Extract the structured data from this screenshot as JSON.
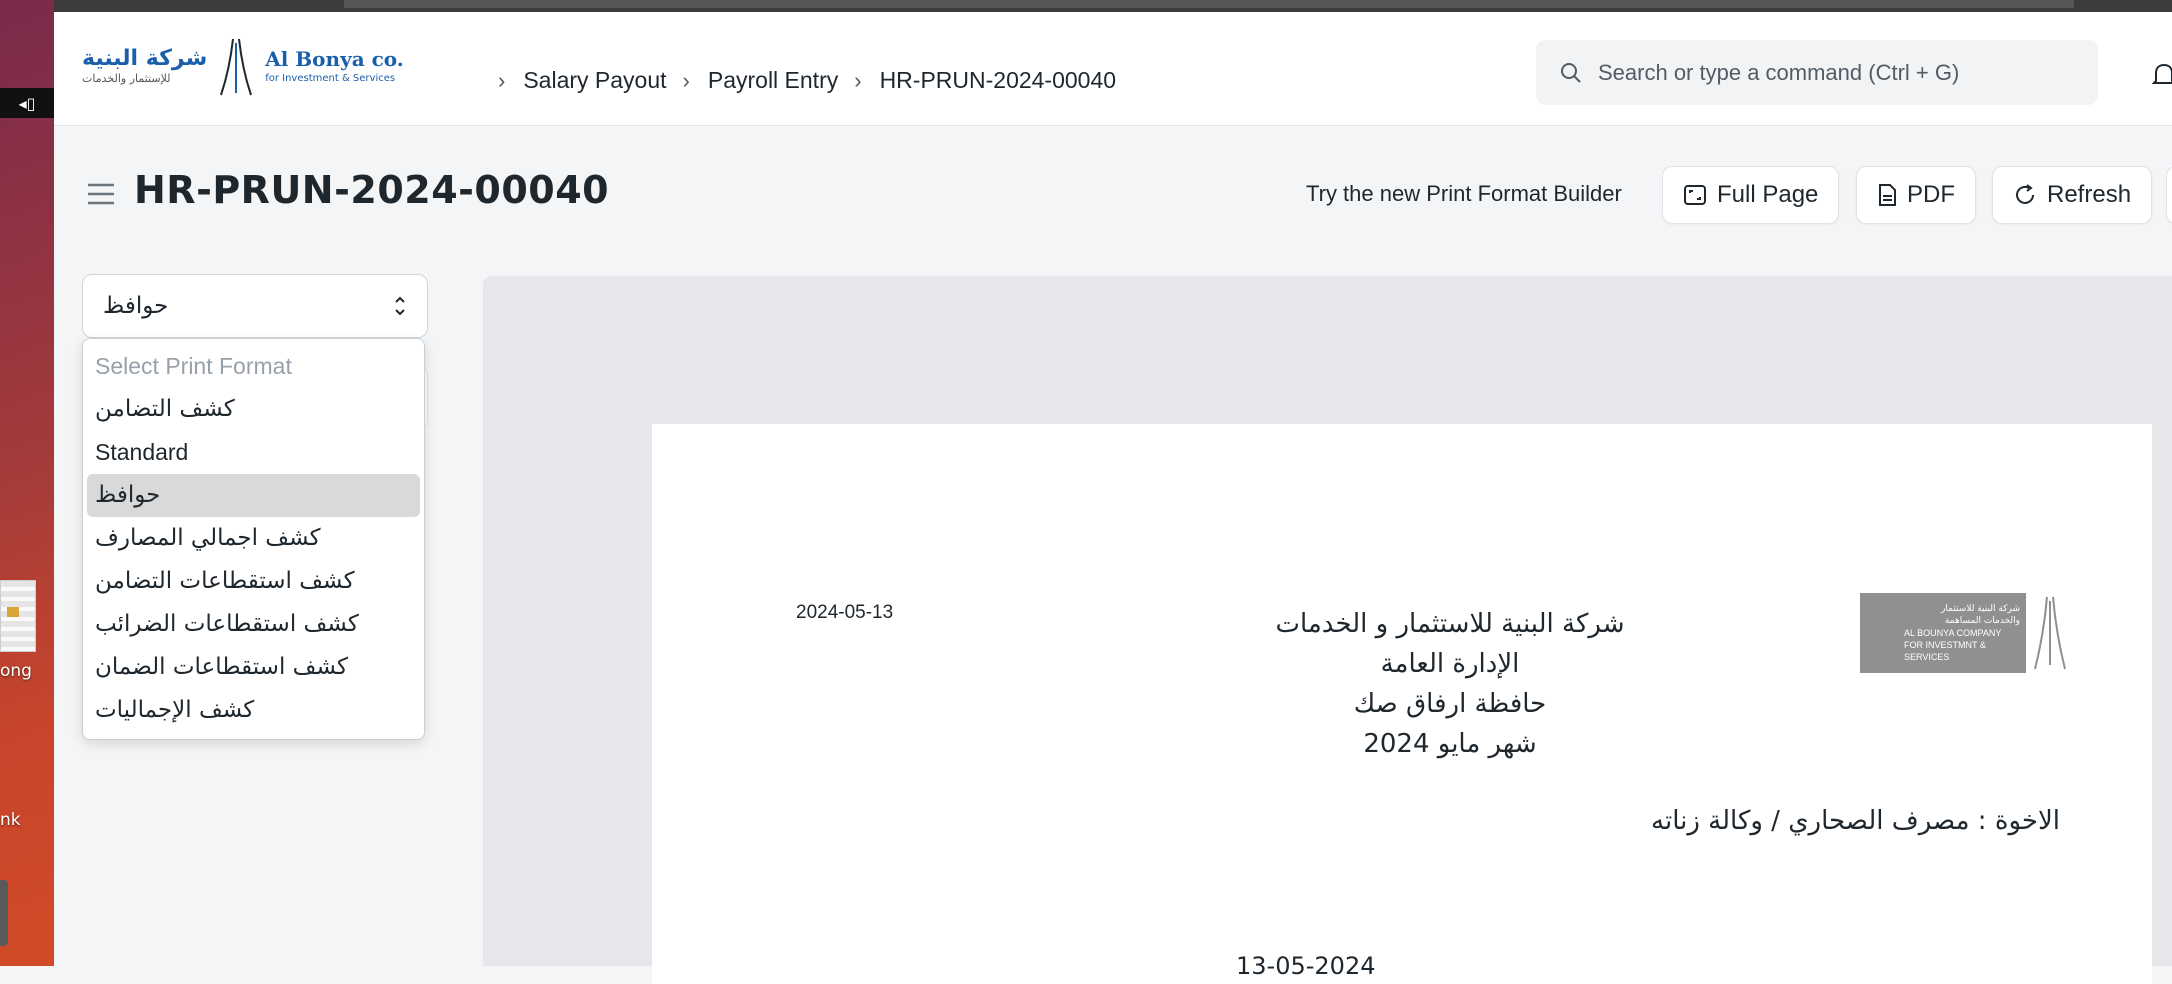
{
  "desktop": {
    "indicator": "◂▯",
    "label_1": "ong",
    "label_2": "nk"
  },
  "brand": {
    "arabic_name": "شركة البنية",
    "arabic_tagline": "للإستثمار والخدمات",
    "english_name": "Al Bonya co.",
    "english_tagline": "for Investment & Services",
    "color": "#1b5fab"
  },
  "breadcrumbs": [
    "Salary Payout",
    "Payroll Entry",
    "HR-PRUN-2024-00040"
  ],
  "search": {
    "placeholder": "Search or type a command (Ctrl + G)"
  },
  "page": {
    "title": "HR-PRUN-2024-00040",
    "try_builder": "Try the new Print Format Builder"
  },
  "toolbar": {
    "full_page": "Full Page",
    "pdf": "PDF",
    "refresh": "Refresh"
  },
  "print_format": {
    "selected": "حوافظ",
    "options": [
      "Select Print Format",
      "كشف التضامن",
      "Standard",
      "حوافظ",
      "كشف اجمالي المصارف",
      "كشف استقطاعات التضامن",
      "كشف استقطاعات الضرائب",
      "كشف استقطاعات الضمان",
      "كشف الإجماليات"
    ]
  },
  "document": {
    "date": "2024-05-13",
    "company": "شركة البنية للاستثمار و الخدمات",
    "department": "الإدارة العامة",
    "title": "حافظة ارفاق صك",
    "month": "شهر مايو 2024",
    "addressee": "الاخوة : مصرف الصحاري / وكالة زناته",
    "logo_ar_1": "شركة البنية للاستثمار",
    "logo_ar_2": "والخدمات المساهمة",
    "logo_en_1": "AL BOUNYA COMPANY",
    "logo_en_2": "FOR INVESTMNT & SERVICES",
    "cut_line": "13-05-2024"
  }
}
